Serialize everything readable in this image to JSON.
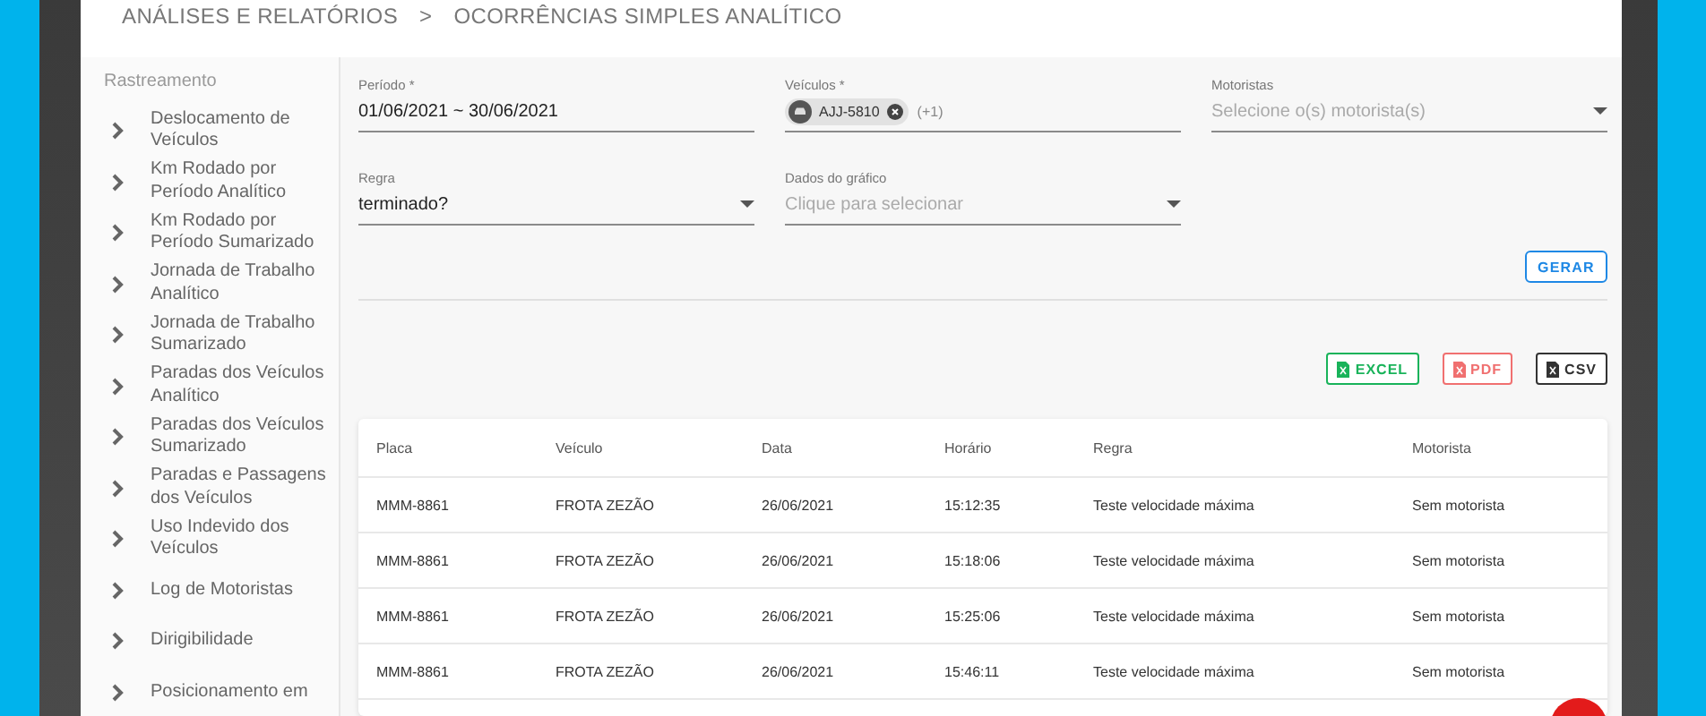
{
  "breadcrumb": [
    "ANÁLISES E RELATÓRIOS",
    ">",
    "OCORRÊNCIAS SIMPLES ANALÍTICO"
  ],
  "sidebar": {
    "section": "Rastreamento",
    "items": [
      {
        "label": "Deslocamento de Veículos"
      },
      {
        "label": "Km Rodado por Período Analítico"
      },
      {
        "label": "Km Rodado por Período Sumarizado"
      },
      {
        "label": "Jornada de Trabalho Analítico"
      },
      {
        "label": "Jornada de Trabalho Sumarizado"
      },
      {
        "label": "Paradas dos Veículos Analítico"
      },
      {
        "label": "Paradas dos Veículos Sumarizado"
      },
      {
        "label": "Paradas e Passagens dos Veículos"
      },
      {
        "label": "Uso Indevido dos Veículos"
      },
      {
        "label": "Log de Motoristas"
      },
      {
        "label": "Dirigibilidade"
      },
      {
        "label": "Posicionamento em"
      }
    ]
  },
  "fields": [
    {
      "kind": "text",
      "label": "Período *",
      "value": "01/06/2021 ~ 30/06/2021"
    },
    {
      "kind": "chips",
      "label": "Veículos *",
      "chips": [
        "AJJ-5810"
      ],
      "extra": "(+1)"
    },
    {
      "kind": "select",
      "label": "Motoristas",
      "placeholder": "Selecione o(s) motorista(s)"
    },
    {
      "kind": "select",
      "label": "Regra",
      "value": "terminado?"
    },
    {
      "kind": "select",
      "label": "Dados do gráfico",
      "placeholder": "Clique para selecionar"
    }
  ],
  "generate_button": "GERAR",
  "exports": [
    {
      "label": "EXCEL",
      "color": "#19b35a"
    },
    {
      "label": "PDF",
      "color": "#f07070"
    },
    {
      "label": "CSV",
      "color": "#333333"
    }
  ],
  "table": {
    "columns": [
      "Placa",
      "Veículo",
      "Data",
      "Horário",
      "Regra",
      "Motorista"
    ],
    "rows": [
      [
        "MMM-8861",
        "FROTA ZEZÃO",
        "26/06/2021",
        "15:12:35",
        "Teste velocidade máxima",
        "Sem motorista"
      ],
      [
        "MMM-8861",
        "FROTA ZEZÃO",
        "26/06/2021",
        "15:18:06",
        "Teste velocidade máxima",
        "Sem motorista"
      ],
      [
        "MMM-8861",
        "FROTA ZEZÃO",
        "26/06/2021",
        "15:25:06",
        "Teste velocidade máxima",
        "Sem motorista"
      ],
      [
        "MMM-8861",
        "FROTA ZEZÃO",
        "26/06/2021",
        "15:46:11",
        "Teste velocidade máxima",
        "Sem motorista"
      ]
    ]
  }
}
